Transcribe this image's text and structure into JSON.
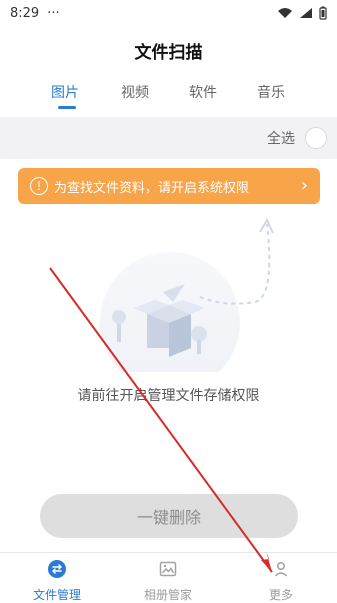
{
  "status_bar": {
    "time": "8:29",
    "dots": "···"
  },
  "page": {
    "title": "文件扫描"
  },
  "tabs": [
    {
      "label": "图片",
      "active": true
    },
    {
      "label": "视频",
      "active": false
    },
    {
      "label": "软件",
      "active": false
    },
    {
      "label": "音乐",
      "active": false
    }
  ],
  "select_all": {
    "label": "全选"
  },
  "banner": {
    "text": "为查找文件资料，请开启系统权限"
  },
  "empty": {
    "message": "请前往开启管理文件存储权限"
  },
  "actions": {
    "delete_label": "一键删除"
  },
  "bottom_nav": [
    {
      "label": "文件管理",
      "active": true
    },
    {
      "label": "相册管家",
      "active": false
    },
    {
      "label": "更多",
      "active": false
    }
  ],
  "colors": {
    "accent": "#2a7bd6",
    "banner": "#f8a449",
    "button_disabled": "#dedede",
    "annotation_arrow": "#d62b2b"
  }
}
